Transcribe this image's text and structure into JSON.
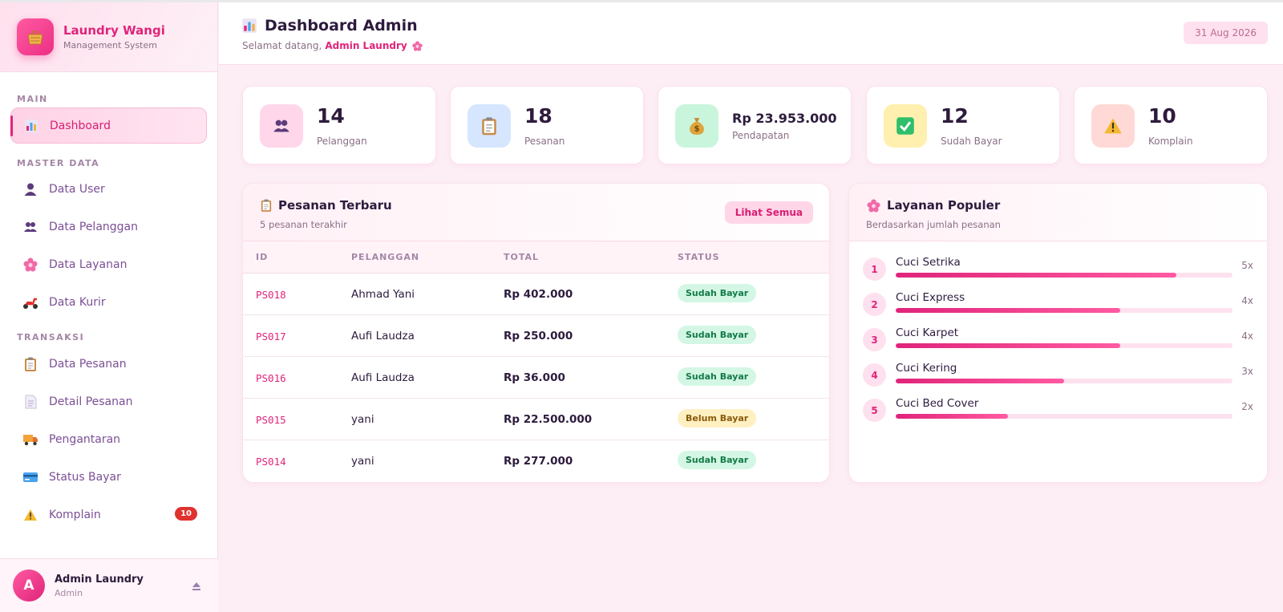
{
  "brand": {
    "name": "Laundry Wangi",
    "subtitle": "Management System"
  },
  "nav": {
    "sections": [
      "MAIN",
      "MASTER DATA",
      "TRANSAKSI"
    ],
    "items": [
      {
        "label": "Dashboard",
        "icon": "chart-icon",
        "active": true
      },
      {
        "label": "Data User",
        "icon": "user-icon"
      },
      {
        "label": "Data Pelanggan",
        "icon": "users-icon"
      },
      {
        "label": "Data Layanan",
        "icon": "flower-icon"
      },
      {
        "label": "Data Kurir",
        "icon": "scooter-icon"
      },
      {
        "label": "Data Pesanan",
        "icon": "clipboard-icon"
      },
      {
        "label": "Detail Pesanan",
        "icon": "document-icon"
      },
      {
        "label": "Pengantaran",
        "icon": "truck-icon"
      },
      {
        "label": "Status Bayar",
        "icon": "card-icon"
      },
      {
        "label": "Komplain",
        "icon": "warning-icon",
        "badge": "10"
      }
    ]
  },
  "user": {
    "initial": "A",
    "name": "Admin Laundry",
    "role": "Admin"
  },
  "header": {
    "title": "Dashboard Admin",
    "greeting": "Selamat datang,",
    "greeting_name": "Admin Laundry",
    "date": "31 Aug 2026"
  },
  "stats": [
    {
      "value": "14",
      "label": "Pelanggan",
      "icon": "users-icon",
      "bg": "#ffd6ea"
    },
    {
      "value": "18",
      "label": "Pesanan",
      "icon": "clipboard-icon",
      "bg": "#d6e6ff"
    },
    {
      "value": "Rp 23.953.000",
      "label": "Pendapatan",
      "icon": "money-bag-icon",
      "bg": "#c9f5dd"
    },
    {
      "value": "12",
      "label": "Sudah Bayar",
      "icon": "check-icon",
      "bg": "#fff0b0"
    },
    {
      "value": "10",
      "label": "Komplain",
      "icon": "warning-icon",
      "bg": "#ffd9d6"
    }
  ],
  "orders": {
    "title": "Pesanan Terbaru",
    "subtitle": "5 pesanan terakhir",
    "button": "Lihat Semua",
    "columns": [
      "ID",
      "PELANGGAN",
      "TOTAL",
      "STATUS"
    ],
    "rows": [
      {
        "id": "PS018",
        "customer": "Ahmad Yani",
        "total": "Rp 402.000",
        "status": "Sudah Bayar",
        "paid": true
      },
      {
        "id": "PS017",
        "customer": "Aufi Laudza",
        "total": "Rp 250.000",
        "status": "Sudah Bayar",
        "paid": true
      },
      {
        "id": "PS016",
        "customer": "Aufi Laudza",
        "total": "Rp 36.000",
        "status": "Sudah Bayar",
        "paid": true
      },
      {
        "id": "PS015",
        "customer": "yani",
        "total": "Rp 22.500.000",
        "status": "Belum Bayar",
        "paid": false
      },
      {
        "id": "PS014",
        "customer": "yani",
        "total": "Rp 277.000",
        "status": "Sudah Bayar",
        "paid": true
      }
    ]
  },
  "services": {
    "title": "Layanan Populer",
    "subtitle": "Berdasarkan jumlah pesanan",
    "items": [
      {
        "rank": "1",
        "name": "Cuci Setrika",
        "count": "5x",
        "fraction": 0.834
      },
      {
        "rank": "2",
        "name": "Cuci Express",
        "count": "4x",
        "fraction": 0.667
      },
      {
        "rank": "3",
        "name": "Cuci Karpet",
        "count": "4x",
        "fraction": 0.667
      },
      {
        "rank": "4",
        "name": "Cuci Kering",
        "count": "3x",
        "fraction": 0.5
      },
      {
        "rank": "5",
        "name": "Cuci Bed Cover",
        "count": "2x",
        "fraction": 0.334
      }
    ]
  },
  "colors": {
    "accent": "#e0247a",
    "accent_light": "#ffe0ee",
    "paid": "#137a48",
    "unpaid": "#8a5a0a"
  }
}
